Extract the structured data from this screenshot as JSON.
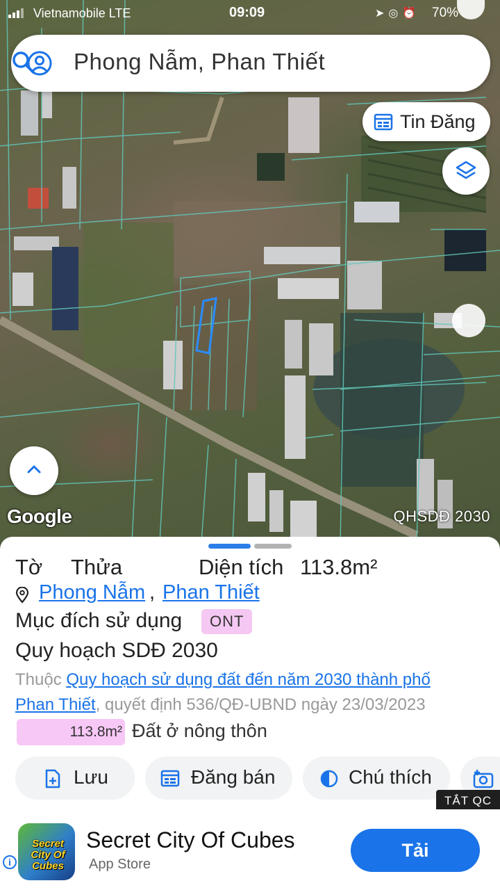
{
  "status_bar": {
    "carrier": "Vietnamobile  LTE",
    "time": "09:09",
    "battery": "70%"
  },
  "search": {
    "query": "Phong Nẫm, Phan Thiết"
  },
  "map": {
    "tin_dang_label": "Tin Đăng",
    "google_logo": "Google",
    "layer_label": "QHSDĐ 2030"
  },
  "parcel": {
    "to_label": "Tờ",
    "thua_label": "Thửa",
    "area_label": "Diện tích",
    "area_value": "113.8m²",
    "ward_link": "Phong Nẫm",
    "city_link": "Phan Thiết",
    "purpose_label": "Mục đích sử dụng",
    "purpose_code": "ONT",
    "plan_title": "Quy hoạch SDĐ 2030",
    "belongs_prefix": "Thuộc ",
    "plan_link_1": "Quy hoạch sử dụng đất đến năm 2030 thành phố",
    "plan_link_2": "Phan Thiết",
    "decision_text": ", quyết định 536/QĐ-UBND ngày 23/03/2023",
    "legend_area": "113.8m²",
    "legend_text": "Đất ở nông thôn"
  },
  "actions": {
    "save": "Lưu",
    "sell": "Đăng bán",
    "legend": "Chú thích"
  },
  "ad": {
    "hide_label": "TẮT QC",
    "title": "Secret City Of Cubes",
    "store": "App Store",
    "cta": "Tải",
    "icon_text": "Secret City Of Cubes",
    "info_icon_text": "i"
  },
  "colors": {
    "accent": "#1a73e8",
    "ont_badge": "#f4c8f2",
    "parcel_lines": "#62c6b8",
    "selected_parcel": "#2a8cff"
  }
}
